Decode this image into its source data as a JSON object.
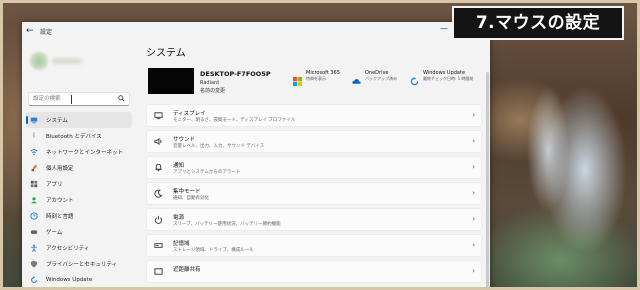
{
  "banner": {
    "title": "7.マウスの設定"
  },
  "window": {
    "title": "設定",
    "back_icon": "back-arrow-icon",
    "minimize_glyph": "—"
  },
  "sidebar": {
    "search": {
      "placeholder": "設定の検索"
    },
    "items": [
      {
        "label": "システム",
        "icon": "monitor-icon",
        "active": true
      },
      {
        "label": "Bluetooth とデバイス",
        "icon": "bluetooth-icon"
      },
      {
        "label": "ネットワークとインターネット",
        "icon": "wifi-icon"
      },
      {
        "label": "個人用設定",
        "icon": "brush-icon"
      },
      {
        "label": "アプリ",
        "icon": "apps-icon"
      },
      {
        "label": "アカウント",
        "icon": "account-icon"
      },
      {
        "label": "時刻と言語",
        "icon": "clock-globe-icon"
      },
      {
        "label": "ゲーム",
        "icon": "gamepad-icon"
      },
      {
        "label": "アクセシビリティ",
        "icon": "accessibility-icon"
      },
      {
        "label": "プライバシーとセキュリティ",
        "icon": "shield-icon"
      },
      {
        "label": "Windows Update",
        "icon": "update-icon"
      }
    ]
  },
  "main": {
    "title": "システム",
    "device": {
      "name": "DESKTOP-F7FOO5P",
      "model": "Radiant",
      "rename": "名前の変更"
    },
    "quick": [
      {
        "title": "Microsoft 365",
        "sub": "特典を表示",
        "icon": "microsoft-365-icon"
      },
      {
        "title": "OneDrive",
        "sub": "バックアップ済み",
        "icon": "onedrive-icon"
      },
      {
        "title": "Windows Update",
        "sub": "最終チェック日時: 1 時間前",
        "icon": "windows-update-icon"
      }
    ],
    "rows": [
      {
        "title": "ディスプレイ",
        "sub": "モニター、明るさ、夜間モード、ディスプレイ プロファイル",
        "icon": "display-icon"
      },
      {
        "title": "サウンド",
        "sub": "音量レベル、出力、入力、サウンド デバイス",
        "icon": "sound-icon"
      },
      {
        "title": "通知",
        "sub": "アプリとシステムからのアラート",
        "icon": "bell-icon"
      },
      {
        "title": "集中モード",
        "sub": "通知、自動有効化",
        "icon": "focus-icon"
      },
      {
        "title": "電源",
        "sub": "スリープ、バッテリー使用状況、バッテリー節約機能",
        "icon": "power-icon"
      },
      {
        "title": "記憶域",
        "sub": "ストレージ領域、ドライブ、構成ルール",
        "icon": "storage-icon"
      },
      {
        "title": "近距離共有",
        "sub": "",
        "icon": "share-icon"
      }
    ],
    "chevron": "›"
  },
  "colors": {
    "accent": "#0067c0",
    "ms_red": "#f25022",
    "ms_green": "#7fba00",
    "ms_blue": "#00a4ef",
    "ms_yellow": "#ffb900"
  }
}
